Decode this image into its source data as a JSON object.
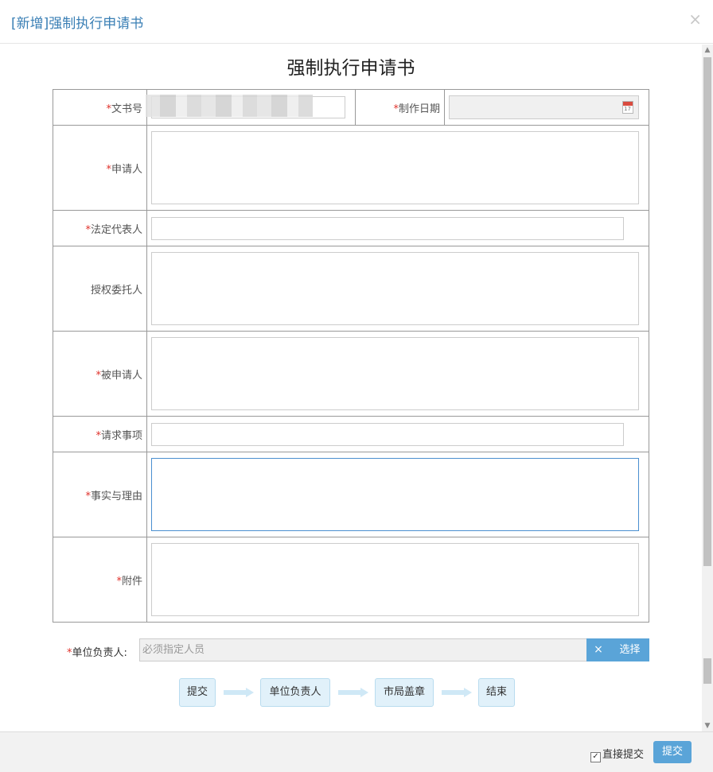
{
  "dialog": {
    "title": "[新增]强制执行申请书",
    "close_glyph": "×"
  },
  "document": {
    "title": "强制执行申请书"
  },
  "form": {
    "required_mark": "*",
    "doc_no_label": "文书号",
    "date_label": "制作日期",
    "applicant_label": "申请人",
    "legal_rep_label": "法定代表人",
    "agent_label": "授权委托人",
    "respondent_label": "被申请人",
    "request_label": "请求事项",
    "facts_label": "事实与理由",
    "attachment_label": "附件"
  },
  "responsible": {
    "label": "单位负责人:",
    "placeholder": "必须指定人员",
    "clear_glyph": "×",
    "select_label": "选择"
  },
  "flow": {
    "steps": [
      "提交",
      "单位负责人",
      "市局盖章",
      "结束"
    ]
  },
  "footer": {
    "direct_submit_label": "直接提交",
    "direct_submit_checked": true,
    "submit_label": "提交"
  },
  "colors": {
    "accent": "#5aa4d8",
    "required": "#e0312b",
    "title": "#3a7fb5"
  }
}
